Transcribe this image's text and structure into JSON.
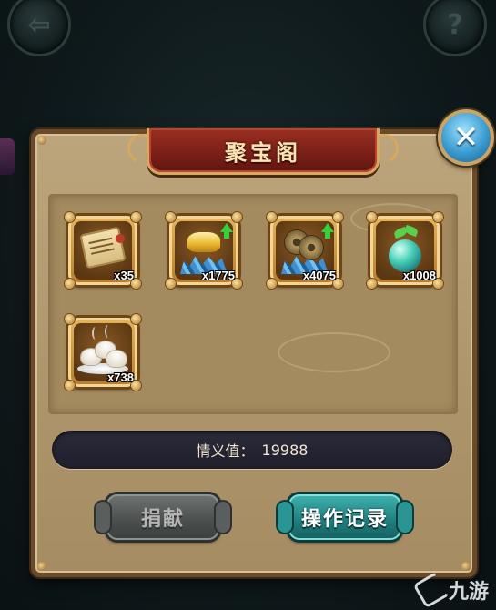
{
  "dialog": {
    "title": "聚宝阁",
    "close_icon": "close-icon",
    "close_symbol": "✕"
  },
  "nav": {
    "back_icon": "back-arrow-icon",
    "back_symbol": "⇦",
    "help_icon": "help-icon",
    "help_symbol": "?"
  },
  "items": [
    {
      "icon": "scroll-icon",
      "quantity": "x35"
    },
    {
      "icon": "gold-ingot-upgrade-icon",
      "quantity": "x1775"
    },
    {
      "icon": "copper-coin-upgrade-icon",
      "quantity": "x4075"
    },
    {
      "icon": "sprout-orb-icon",
      "quantity": "x1008"
    },
    {
      "icon": "steamed-buns-icon",
      "quantity": "x738"
    }
  ],
  "stat": {
    "label": "情义值：",
    "value": "19988"
  },
  "buttons": {
    "donate": "捐献",
    "log": "操作记录"
  },
  "watermark": {
    "text": "九游"
  },
  "colors": {
    "panel": "#b39b73",
    "title_banner": "#7a1f17",
    "log_button": "#1f7d7d",
    "donate_button": "#4a4f4d",
    "close_button": "#3a9bd0"
  }
}
